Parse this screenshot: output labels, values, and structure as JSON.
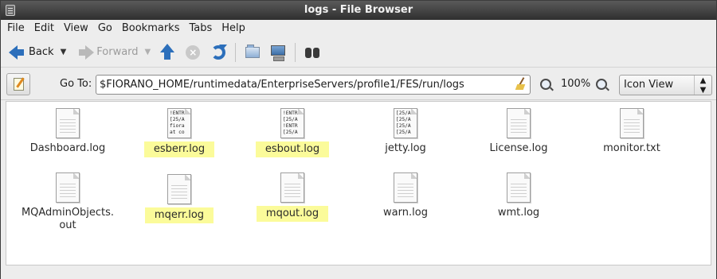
{
  "window": {
    "title": "logs - File Browser"
  },
  "menubar": {
    "items": [
      "File",
      "Edit",
      "View",
      "Go",
      "Bookmarks",
      "Tabs",
      "Help"
    ]
  },
  "toolbar": {
    "back_label": "Back",
    "forward_label": "Forward"
  },
  "location": {
    "goto_label": "Go To:",
    "path": "$FIORANO_HOME/runtimedata/EnterpriseServers/profile1/FES/run/logs",
    "zoom_level": "100%",
    "view_mode": "Icon View"
  },
  "files": [
    {
      "name": "Dashboard.log",
      "highlighted": false,
      "preview": ""
    },
    {
      "name": "esberr.log",
      "highlighted": true,
      "preview": "!ENTR\n[25/A\nfiora\nat co"
    },
    {
      "name": "esbout.log",
      "highlighted": true,
      "preview": "!ENTR\n[25/A\n!ENTR\n[25/A"
    },
    {
      "name": "jetty.log",
      "highlighted": false,
      "preview": "[25/A\n[25/A\n[25/A\n[25/A"
    },
    {
      "name": "License.log",
      "highlighted": false,
      "preview": ""
    },
    {
      "name": "monitor.txt",
      "highlighted": false,
      "preview": ""
    },
    {
      "name": "MQAdminObjects.\nout",
      "highlighted": false,
      "preview": ""
    },
    {
      "name": "mqerr.log",
      "highlighted": true,
      "preview": ""
    },
    {
      "name": "mqout.log",
      "highlighted": true,
      "preview": ""
    },
    {
      "name": "warn.log",
      "highlighted": false,
      "preview": ""
    },
    {
      "name": "wmt.log",
      "highlighted": false,
      "preview": ""
    }
  ],
  "colors": {
    "highlight": "#fbfb9a",
    "accent_icon": "#2c6fbb",
    "titlebar": "#3a3a3a"
  }
}
